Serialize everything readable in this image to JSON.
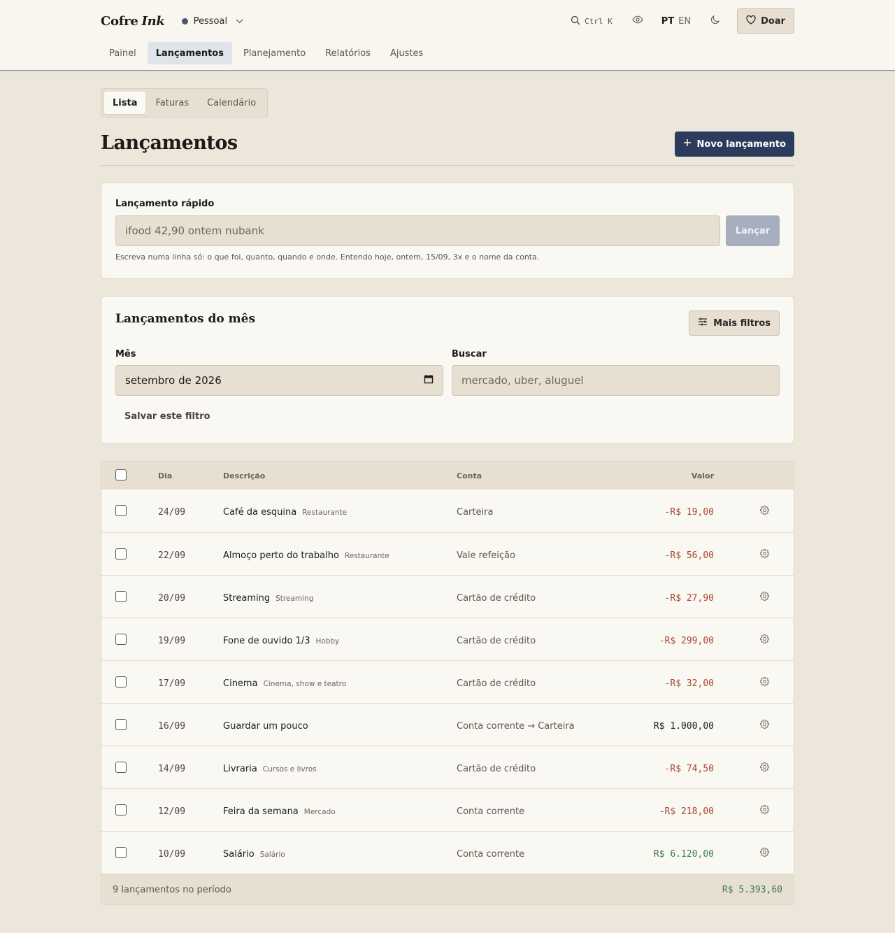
{
  "header": {
    "brand_main": "Cofre",
    "brand_accent": "Ink",
    "profile": "Pessoal",
    "search_shortcut": "Ctrl K",
    "lang_active": "PT",
    "lang_other": "EN",
    "donate": "Doar",
    "nav": [
      "Painel",
      "Lançamentos",
      "Planejamento",
      "Relatórios",
      "Ajustes"
    ],
    "nav_active": 1
  },
  "subtabs": [
    "Lista",
    "Faturas",
    "Calendário"
  ],
  "page": {
    "title": "Lançamentos",
    "new_button": "Novo lançamento"
  },
  "quick_entry": {
    "label": "Lançamento rápido",
    "placeholder": "ifood 42,90 ontem nubank",
    "button": "Lançar",
    "help": "Escreva numa linha só: o que foi, quanto, quando e onde. Entendo hoje, ontem, 15/09, 3x e o nome da conta."
  },
  "filters": {
    "title": "Lançamentos do mês",
    "more_filters": "Mais filtros",
    "month_label": "Mês",
    "month_value": "setembro de 2026",
    "search_label": "Buscar",
    "search_placeholder": "mercado, uber, aluguel",
    "save_filter": "Salvar este filtro"
  },
  "table": {
    "columns": {
      "day": "Dia",
      "description": "Descrição",
      "account": "Conta",
      "value": "Valor"
    },
    "rows": [
      {
        "day": "24/09",
        "desc": "Café da esquina",
        "cat": "Restaurante",
        "account": "Carteira",
        "value": "-R$ 19,00",
        "kind": "neg"
      },
      {
        "day": "22/09",
        "desc": "Almoço perto do trabalho",
        "cat": "Restaurante",
        "account": "Vale refeição",
        "value": "-R$ 56,00",
        "kind": "neg"
      },
      {
        "day": "20/09",
        "desc": "Streaming",
        "cat": "Streaming",
        "account": "Cartão de crédito",
        "value": "-R$ 27,90",
        "kind": "neg"
      },
      {
        "day": "19/09",
        "desc": "Fone de ouvido 1/3",
        "cat": "Hobby",
        "account": "Cartão de crédito",
        "value": "-R$ 299,00",
        "kind": "neg"
      },
      {
        "day": "17/09",
        "desc": "Cinema",
        "cat": "Cinema, show e teatro",
        "account": "Cartão de crédito",
        "value": "-R$ 32,00",
        "kind": "neg"
      },
      {
        "day": "16/09",
        "desc": "Guardar um pouco",
        "cat": "",
        "account": "Conta corrente → Carteira",
        "value": "R$ 1.000,00",
        "kind": "neu"
      },
      {
        "day": "14/09",
        "desc": "Livraria",
        "cat": "Cursos e livros",
        "account": "Cartão de crédito",
        "value": "-R$ 74,50",
        "kind": "neg"
      },
      {
        "day": "12/09",
        "desc": "Feira da semana",
        "cat": "Mercado",
        "account": "Conta corrente",
        "value": "-R$ 218,00",
        "kind": "neg"
      },
      {
        "day": "10/09",
        "desc": "Salário",
        "cat": "Salário",
        "account": "Conta corrente",
        "value": "R$ 6.120,00",
        "kind": "pos"
      }
    ],
    "footer_count": "9 lançamentos no período",
    "footer_total": "R$ 5.393,60"
  },
  "colors": {
    "primary": "#2a3b5c",
    "negative": "#a5472f",
    "positive": "#3d7a4f",
    "background": "#ede7db"
  }
}
